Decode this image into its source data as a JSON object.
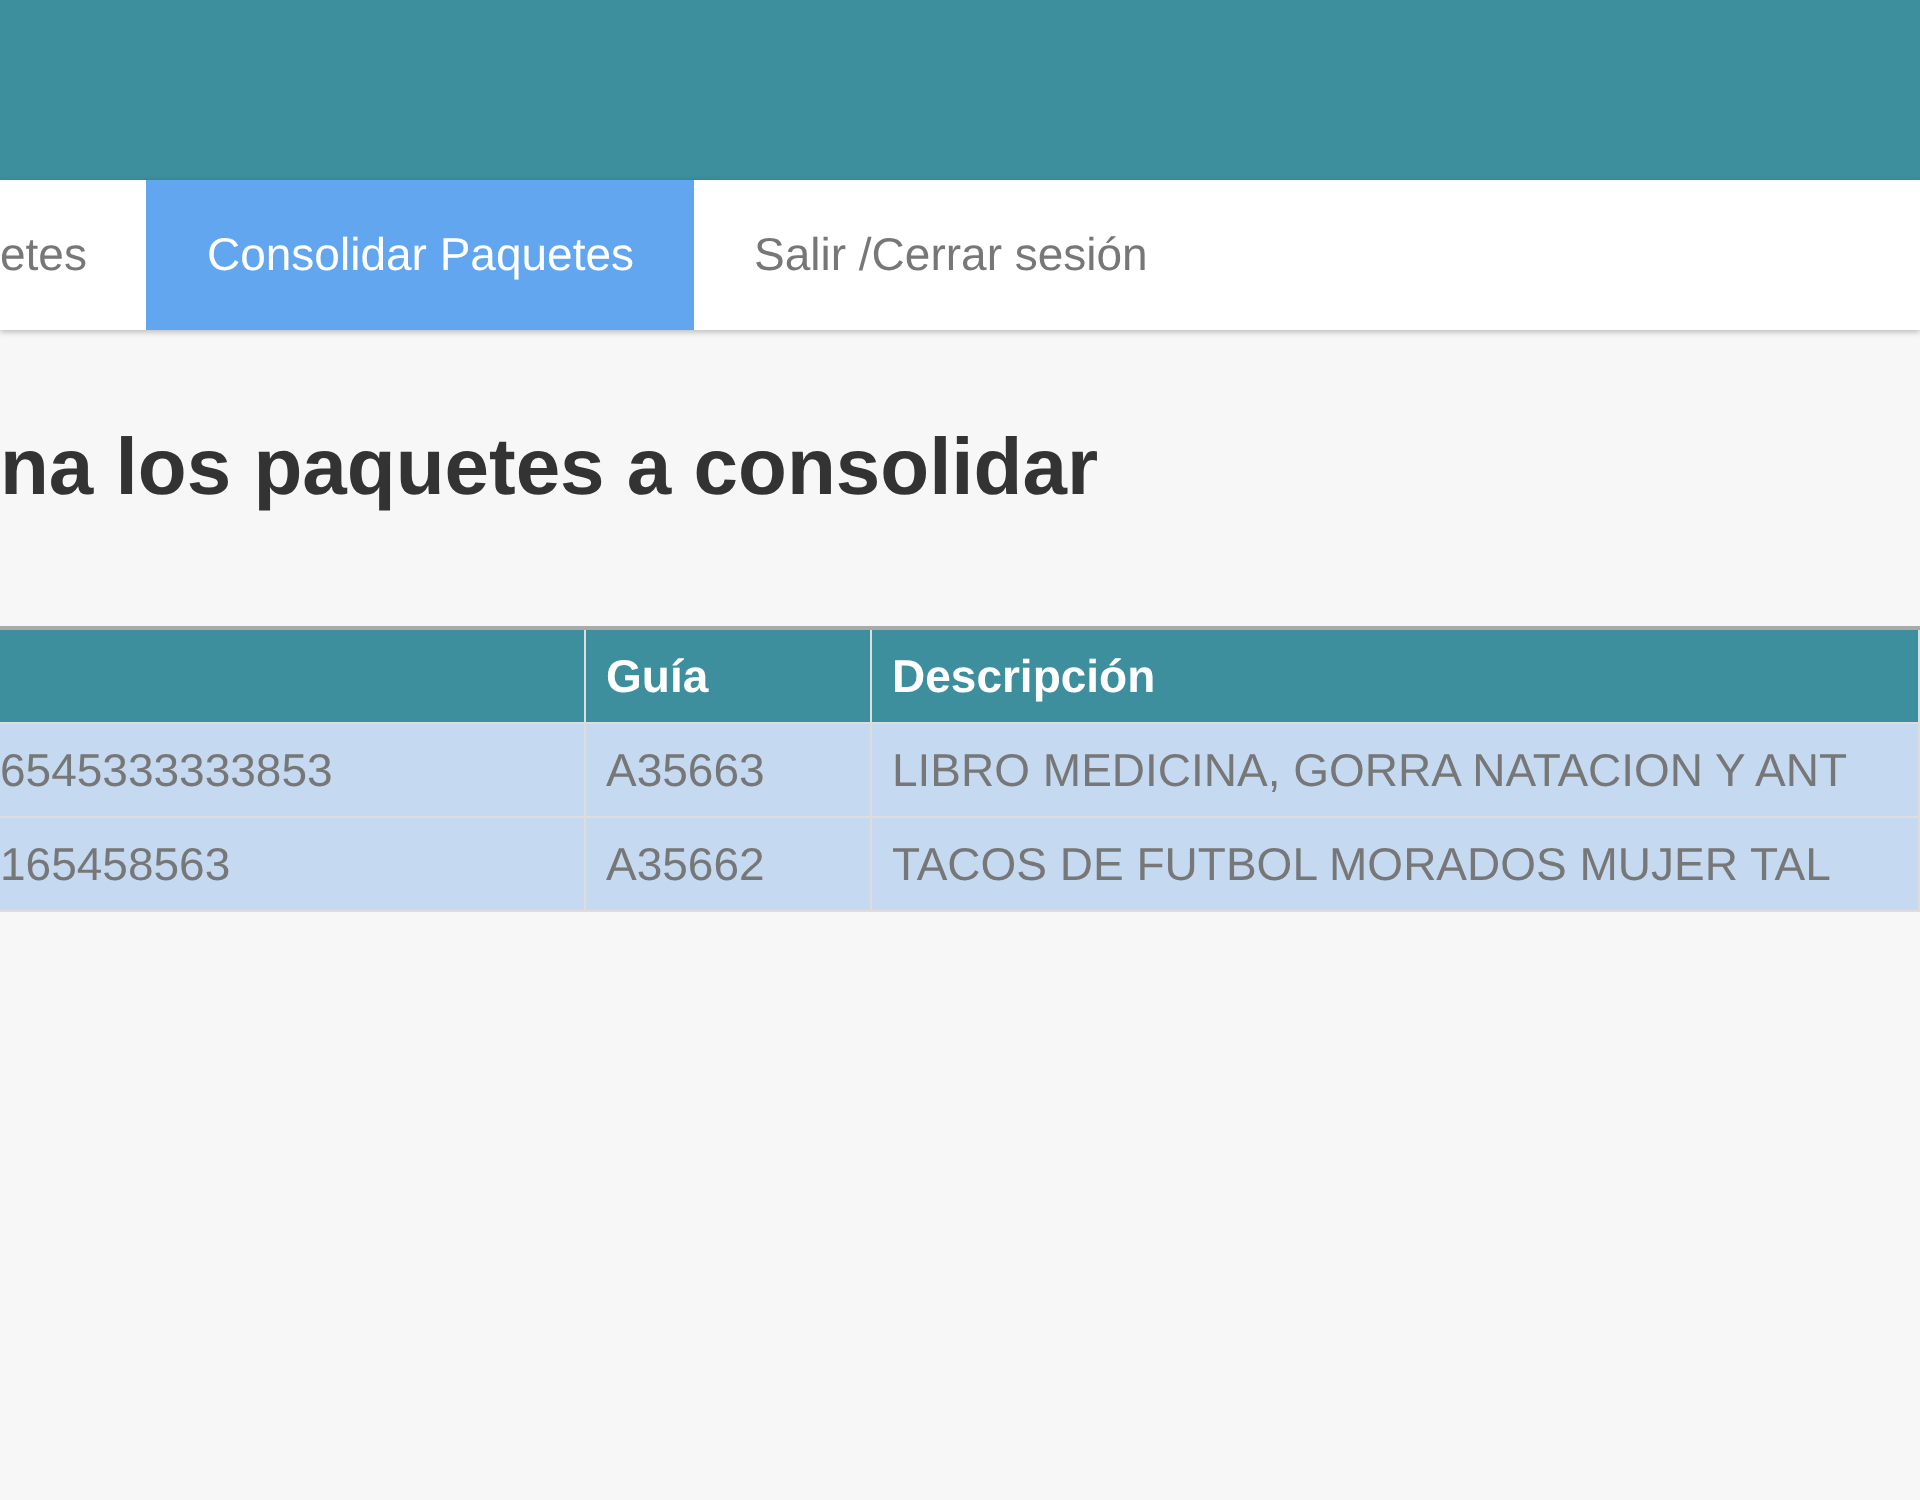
{
  "nav": {
    "tabs": [
      {
        "label": "etes",
        "selected": false
      },
      {
        "label": "Consolidar Paquetes",
        "selected": true
      },
      {
        "label": "Salir /Cerrar sesión",
        "selected": false
      }
    ]
  },
  "heading": "na los paquetes a consolidar",
  "table": {
    "columns": [
      "",
      "Guía",
      "Descripción"
    ],
    "rows": [
      [
        "6545333333853",
        "A35663",
        "LIBRO MEDICINA, GORRA NATACION Y ANT"
      ],
      [
        "165458563",
        "A35662",
        "TACOS DE FUTBOL MORADOS MUJER TAL"
      ]
    ]
  }
}
